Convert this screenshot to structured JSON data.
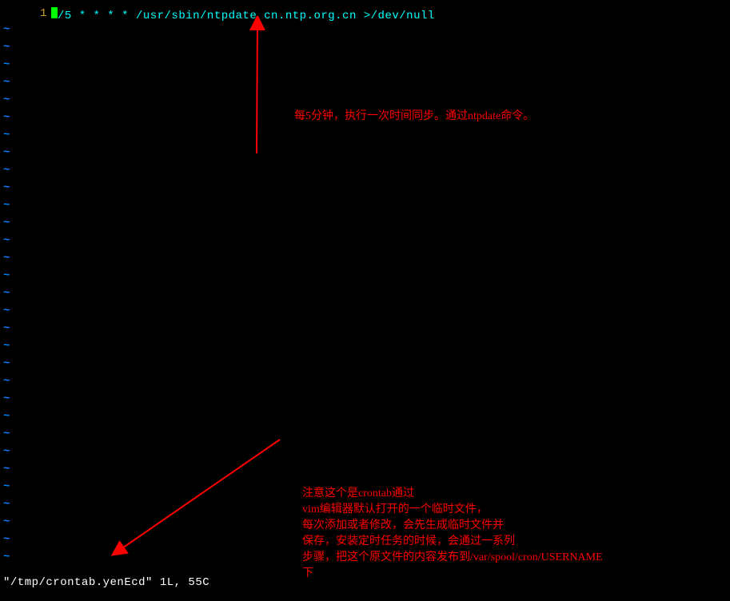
{
  "editor": {
    "line_number": "1",
    "cursor_char": "*",
    "code_content": "/5 * * * * /usr/sbin/ntpdate cn.ntp.org.cn >/dev/null",
    "tilde": "~",
    "tilde_count": 31
  },
  "status": {
    "text": "\"/tmp/crontab.yenEcd\" 1L, 55C"
  },
  "annotations": {
    "note1": "每5分钟，执行一次时间同步。通过ntpdate命令。",
    "note2_line1": "注意这个是crontab通过",
    "note2_line2": "vim编辑器默认打开的一个临时文件，",
    "note2_line3": "每次添加或者修改，会先生成临时文件并",
    "note2_line4": "保存，安装定时任务的时候，会通过一系列",
    "note2_line5": "步骤，把这个原文件的内容发布到/var/spool/cron/USERNAME",
    "note2_line6": "下"
  }
}
